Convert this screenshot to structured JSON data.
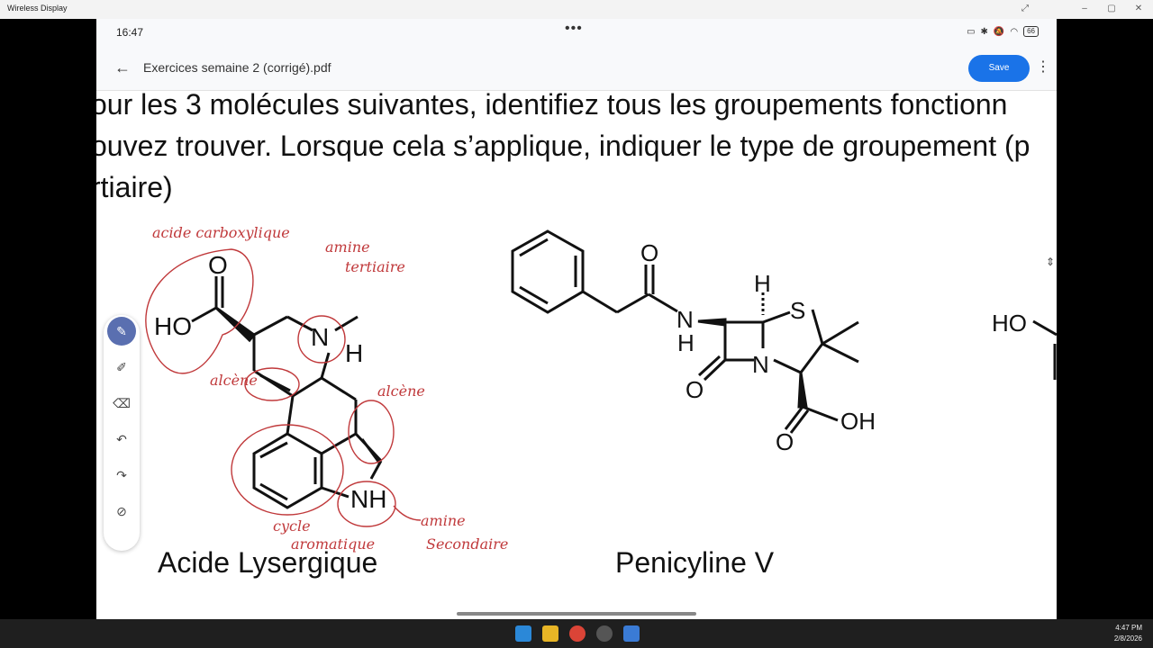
{
  "window": {
    "title": "Wireless Display"
  },
  "status_bar": {
    "time": "16:47",
    "dots": "•••",
    "battery": "66"
  },
  "app_bar": {
    "back_icon": "arrow-left-icon",
    "doc_title": "Exercices semaine 2 (corrigé).pdf",
    "save_label": "Save",
    "more_icon": "more-vert-icon"
  },
  "pdf": {
    "line1": "our les 3 molécules suivantes, identifiez tous les groupements fonctionn",
    "line2": "ouvez trouver. Lorsque cela s’applique, indiquer le type de groupement (p",
    "line3": "rtiaire)",
    "molecule1": {
      "name": "Acide Lysergique",
      "labels": {
        "o": "O",
        "ho": "HO",
        "n": "N",
        "h": "H",
        "nh": "NH"
      },
      "annotations": {
        "carboxylic": "acide carboxylique",
        "amine_t1": "amine",
        "amine_t2": "tertiaire",
        "alkene1": "alcène",
        "alkene2": "alcène",
        "cycle1": "cycle",
        "cycle2": "aromatique",
        "amine_s1": "amine",
        "amine_s2": "Secondaire"
      }
    },
    "molecule2": {
      "name": "Penicyline V",
      "labels": {
        "o1": "O",
        "n1": "N",
        "h1": "H",
        "h_top": "H",
        "s": "S",
        "n2": "N",
        "o2": "O",
        "o3": "O",
        "oh": "OH"
      }
    },
    "molecule3_partial": {
      "ho": "HO"
    }
  },
  "taskbar": {
    "time": "4:47 PM",
    "date": "2/8/2026"
  }
}
